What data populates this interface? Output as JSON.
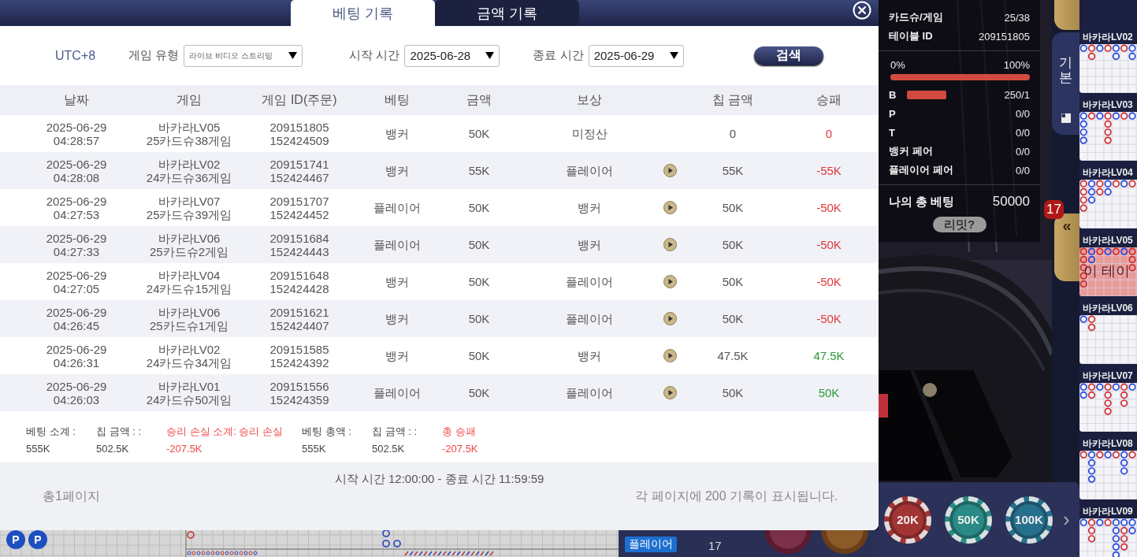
{
  "modal": {
    "tabs": [
      {
        "label": "베팅 기록",
        "selected": true
      },
      {
        "label": "금액 기록",
        "selected": false
      }
    ],
    "filters": {
      "timezone": "UTC+8",
      "game_type": {
        "label": "게임 유형",
        "value": "라이브 비디오 스트리밍"
      },
      "start": {
        "label": "시작 시간",
        "value": "2025-06-28"
      },
      "end": {
        "label": "종료 시간",
        "value": "2025-06-29"
      },
      "search_button": "검색"
    },
    "table": {
      "columns": [
        "날짜",
        "게임",
        "게임 ID(주문)",
        "베팅",
        "금액",
        "보상",
        "칩 금액",
        "승패"
      ],
      "rows": [
        {
          "date": "2025-06-29",
          "time": "04:28:57",
          "game": "바카라LV05",
          "shoe": "25카드슈38게임",
          "game_id": "209151805",
          "order": "152424509",
          "bet": "뱅커",
          "amount": "50K",
          "result": "미정산",
          "replay": false,
          "chips": "0",
          "win_loss": "0",
          "positive": false
        },
        {
          "date": "2025-06-29",
          "time": "04:28:08",
          "game": "바카라LV02",
          "shoe": "24카드슈36게임",
          "game_id": "209151741",
          "order": "152424467",
          "bet": "뱅커",
          "amount": "55K",
          "result": "플레이어",
          "replay": true,
          "chips": "55K",
          "win_loss": "-55K",
          "positive": false
        },
        {
          "date": "2025-06-29",
          "time": "04:27:53",
          "game": "바카라LV07",
          "shoe": "25카드슈39게임",
          "game_id": "209151707",
          "order": "152424452",
          "bet": "플레이어",
          "amount": "50K",
          "result": "뱅커",
          "replay": true,
          "chips": "50K",
          "win_loss": "-50K",
          "positive": false
        },
        {
          "date": "2025-06-29",
          "time": "04:27:33",
          "game": "바카라LV06",
          "shoe": "25카드슈2게임",
          "game_id": "209151684",
          "order": "152424443",
          "bet": "플레이어",
          "amount": "50K",
          "result": "뱅커",
          "replay": true,
          "chips": "50K",
          "win_loss": "-50K",
          "positive": false
        },
        {
          "date": "2025-06-29",
          "time": "04:27:05",
          "game": "바카라LV04",
          "shoe": "24카드슈15게임",
          "game_id": "209151648",
          "order": "152424428",
          "bet": "뱅커",
          "amount": "50K",
          "result": "플레이어",
          "replay": true,
          "chips": "50K",
          "win_loss": "-50K",
          "positive": false
        },
        {
          "date": "2025-06-29",
          "time": "04:26:45",
          "game": "바카라LV06",
          "shoe": "25카드슈1게임",
          "game_id": "209151621",
          "order": "152424407",
          "bet": "뱅커",
          "amount": "50K",
          "result": "플레이어",
          "replay": true,
          "chips": "50K",
          "win_loss": "-50K",
          "positive": false
        },
        {
          "date": "2025-06-29",
          "time": "04:26:31",
          "game": "바카라LV02",
          "shoe": "24카드슈34게임",
          "game_id": "209151585",
          "order": "152424392",
          "bet": "뱅커",
          "amount": "50K",
          "result": "뱅커",
          "replay": true,
          "chips": "47.5K",
          "win_loss": "47.5K",
          "positive": true
        },
        {
          "date": "2025-06-29",
          "time": "04:26:03",
          "game": "바카라LV01",
          "shoe": "24카드슈50게임",
          "game_id": "209151556",
          "order": "152424359",
          "bet": "플레이어",
          "amount": "50K",
          "result": "플레이어",
          "replay": true,
          "chips": "50K",
          "win_loss": "50K",
          "positive": true
        }
      ]
    },
    "summary": [
      {
        "label": "베팅 소계 :",
        "value": "555K",
        "highlighted": false
      },
      {
        "label": "칩 금액 : :",
        "value": "502.5K",
        "highlighted": false
      },
      {
        "label": "승리 손실 소계: 승리 손실",
        "value": "-207.5K",
        "highlighted": true
      },
      {
        "label": "베팅 총액 :",
        "value": "555K",
        "highlighted": false
      },
      {
        "label": "칩 금액 : :",
        "value": "502.5K",
        "highlighted": false
      },
      {
        "label": "총 승패",
        "value": "-207.5K",
        "highlighted": true
      }
    ],
    "footer": {
      "range": "시작 시간 12:00:00 - 종료 시간 11:59:59",
      "pages": "총1페이지",
      "per_page": "각 페이지에 200 기록이 표시됩니다."
    }
  },
  "stats": {
    "rows": [
      {
        "label": "카드슈/게임",
        "value": "25/38"
      },
      {
        "label": "테이블 ID",
        "value": "209151805"
      }
    ],
    "progress": {
      "min": "0%",
      "max": "100%",
      "level": 1.0
    },
    "odds": [
      {
        "label": "B",
        "value": "250/1",
        "level": 0.6
      },
      {
        "label": "P",
        "value": "0/0"
      },
      {
        "label": "T",
        "value": "0/0"
      },
      {
        "label": "뱅커 페어",
        "value": "0/0"
      },
      {
        "label": "플레이어 페어",
        "value": "0/0"
      }
    ],
    "total": {
      "label": "나의 총 베팅",
      "value": "50000"
    },
    "limit_button": "리밋?"
  },
  "side_tabs": {
    "tabs": [
      {
        "label": "기본",
        "selected": true
      }
    ],
    "badge": "17",
    "collapse": "«"
  },
  "roads": [
    {
      "title": "바카라LV02",
      "rows": [
        [
          {
            "color": "#2244dd"
          },
          {
            "color": "#d02a2a"
          },
          {
            "color": "#2244dd"
          },
          {
            "color": "#d02a2a"
          },
          {
            "color": "#2244dd"
          },
          {
            "color": "#d02a2a"
          },
          {
            "color": "#2244dd"
          }
        ],
        [
          null,
          {
            "color": "#d02a2a"
          },
          null,
          null,
          {
            "color": "#2244dd"
          },
          null,
          {
            "color": "#2244dd"
          }
        ]
      ]
    },
    {
      "title": "바카라LV03",
      "rows": [
        [
          {
            "color": "#2244dd"
          },
          {
            "color": "#d02a2a"
          },
          {
            "color": "#2244dd"
          },
          {
            "color": "#d02a2a"
          },
          {
            "color": "#2244dd"
          },
          {
            "color": "#d02a2a"
          },
          {
            "color": "#2244dd"
          }
        ],
        [
          {
            "color": "#2244dd"
          },
          null,
          null,
          {
            "color": "#d02a2a"
          }
        ],
        [
          {
            "color": "#2244dd"
          },
          null,
          null,
          {
            "color": "#d02a2a"
          }
        ],
        [
          {
            "color": "#2244dd"
          },
          null,
          null,
          {
            "color": "#d02a2a"
          }
        ]
      ]
    },
    {
      "title": "바카라LV04",
      "rows": [
        [
          {
            "color": "#d02a2a"
          },
          {
            "color": "#2244dd"
          },
          {
            "color": "#d02a2a"
          },
          {
            "color": "#2244dd"
          },
          {
            "color": "#d02a2a"
          },
          {
            "color": "#2244dd"
          },
          {
            "color": "#d02a2a"
          }
        ],
        [
          {
            "color": "#d02a2a"
          },
          {
            "color": "#2244dd"
          },
          {
            "color": "#d02a2a"
          },
          {
            "color": "#2244dd"
          }
        ],
        [
          {
            "color": "#d02a2a"
          },
          {
            "color": "#2244dd"
          }
        ],
        [
          {
            "color": "#d02a2a"
          }
        ]
      ]
    },
    {
      "title": "바카라LV05",
      "rows": [
        [
          {
            "color": "#d02a2a"
          },
          {
            "color": "#2244dd"
          },
          {
            "color": "#d02a2a"
          },
          {
            "color": "#2244dd"
          },
          {
            "color": "#d02a2a"
          },
          {
            "color": "#2244dd"
          },
          {
            "color": "#d02a2a"
          }
        ],
        [
          {
            "color": "#d02a2a"
          },
          {
            "color": "#2244dd"
          },
          null,
          null,
          null,
          null,
          {
            "color": "#d02a2a"
          }
        ],
        [
          {
            "color": "#d02a2a"
          },
          null,
          null,
          null,
          null,
          null,
          {
            "color": "#d02a2a"
          }
        ],
        [
          {
            "color": "#d02a2a"
          }
        ],
        [
          {
            "color": "#d02a2a"
          }
        ]
      ],
      "overlay": "이 테이"
    },
    {
      "title": "바카라LV06",
      "rows": [
        [
          {
            "color": "#2244dd"
          },
          {
            "color": "#d02a2a"
          }
        ],
        [
          null,
          {
            "color": "#d02a2a"
          }
        ]
      ]
    },
    {
      "title": "바카라LV07",
      "rows": [
        [
          {
            "color": "#2244dd"
          },
          {
            "color": "#d02a2a"
          },
          {
            "color": "#2244dd"
          },
          {
            "color": "#d02a2a"
          },
          {
            "color": "#2244dd"
          },
          {
            "color": "#d02a2a"
          },
          {
            "color": "#2244dd"
          }
        ],
        [
          {
            "color": "#2244dd"
          },
          {
            "color": "#d02a2a"
          },
          null,
          {
            "color": "#d02a2a"
          },
          null,
          {
            "color": "#d02a2a"
          }
        ],
        [
          null,
          null,
          null,
          {
            "color": "#d02a2a"
          },
          null,
          {
            "color": "#d02a2a"
          }
        ],
        [
          null,
          null,
          null,
          {
            "color": "#d02a2a"
          }
        ]
      ]
    },
    {
      "title": "바카라LV08",
      "rows": [
        [
          {
            "color": "#d02a2a"
          },
          {
            "color": "#2244dd"
          },
          {
            "color": "#d02a2a"
          },
          {
            "color": "#2244dd"
          },
          {
            "color": "#d02a2a"
          },
          {
            "color": "#2244dd"
          },
          {
            "color": "#d02a2a"
          }
        ],
        [
          null,
          {
            "color": "#2244dd"
          },
          null,
          null,
          null,
          {
            "color": "#2244dd"
          }
        ],
        [
          null,
          {
            "color": "#2244dd"
          },
          null,
          null,
          null,
          {
            "color": "#2244dd"
          }
        ],
        [
          null,
          {
            "color": "#2244dd"
          }
        ]
      ]
    },
    {
      "title": "바카라LV09",
      "rows": [
        [
          {
            "color": "#2244dd"
          },
          {
            "color": "#d02a2a"
          },
          {
            "color": "#2244dd"
          },
          {
            "color": "#d02a2a"
          },
          {
            "color": "#2244dd"
          },
          {
            "color": "#2244dd"
          },
          {
            "color": "#2244dd"
          }
        ],
        [
          null,
          {
            "color": "#d02a2a"
          },
          null,
          null,
          {
            "color": "#2244dd"
          },
          {
            "color": "#d02a2a"
          },
          {
            "color": "#2244dd"
          }
        ],
        [
          null,
          {
            "color": "#d02a2a"
          },
          null,
          null,
          {
            "color": "#2244dd"
          },
          {
            "color": "#d02a2a"
          }
        ],
        [
          null,
          null,
          null,
          null,
          {
            "color": "#2244dd"
          },
          {
            "color": "#d02a2a"
          }
        ],
        [
          null,
          null,
          null,
          null,
          {
            "color": "#2244dd"
          }
        ]
      ]
    }
  ],
  "bottom": {
    "road_marks": [
      "P",
      "P"
    ],
    "player": {
      "label": "플레이어",
      "value": "17"
    }
  },
  "chips": {
    "items": [
      {
        "label": "20K",
        "color": "#a33434"
      },
      {
        "label": "50K",
        "color": "#2a8a86"
      },
      {
        "label": "100K",
        "color": "#27708c"
      }
    ],
    "next": "›"
  }
}
